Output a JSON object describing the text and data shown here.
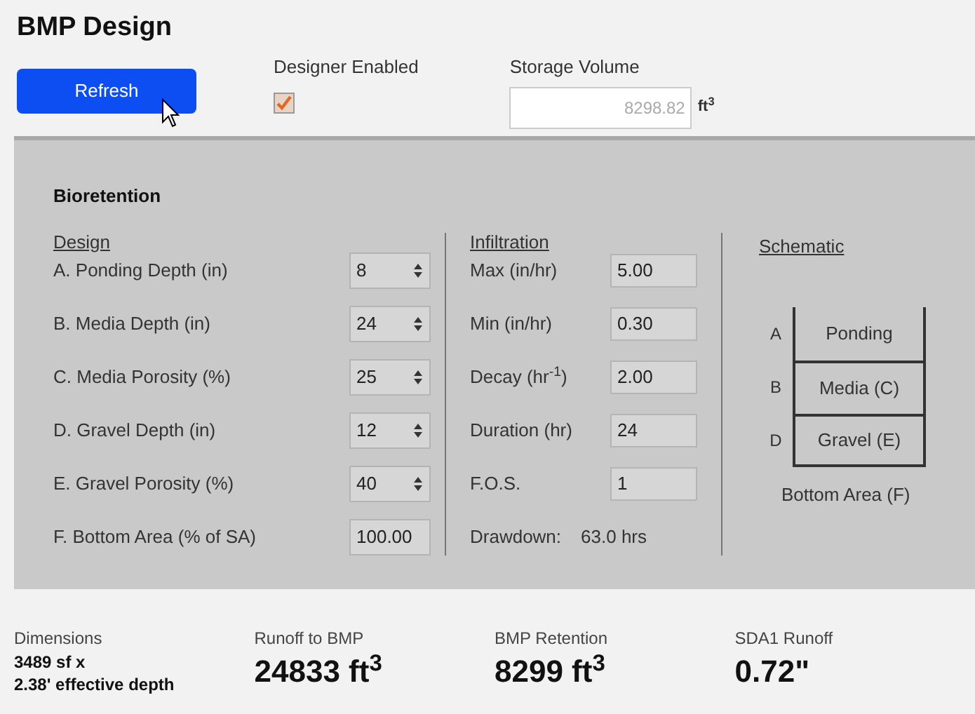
{
  "title": "BMP Design",
  "refresh_button": "Refresh",
  "designer_enabled": {
    "label": "Designer Enabled",
    "checked": true
  },
  "storage_volume": {
    "label": "Storage Volume",
    "value": "8298.82",
    "unit": "ft$^{3}$"
  },
  "panel": {
    "title": "Bioretention",
    "design": {
      "heading": "Design",
      "rows": [
        {
          "label": "A. Ponding Depth (in)",
          "value": "8",
          "kind": "spinner"
        },
        {
          "label": "B. Media Depth (in)",
          "value": "24",
          "kind": "spinner"
        },
        {
          "label": "C. Media Porosity (%)",
          "value": "25",
          "kind": "spinner"
        },
        {
          "label": "D. Gravel Depth (in)",
          "value": "12",
          "kind": "spinner"
        },
        {
          "label": "E. Gravel Porosity (%)",
          "value": "40",
          "kind": "spinner"
        },
        {
          "label": "F. Bottom Area (% of SA)",
          "value": "100.00",
          "kind": "text"
        }
      ]
    },
    "infiltration": {
      "heading": "Infiltration",
      "rows": [
        {
          "label": "Max (in/hr)",
          "value": "5.00"
        },
        {
          "label": "Min (in/hr)",
          "value": "0.30"
        },
        {
          "label": "Decay (hr$^{-1}$)",
          "value": "2.00"
        },
        {
          "label": "Duration (hr)",
          "value": "24"
        },
        {
          "label": "F.O.S.",
          "value": "1"
        }
      ],
      "drawdown": {
        "label": "Drawdown:",
        "value": "63.0 hrs"
      }
    },
    "schematic": {
      "heading": "Schematic",
      "layers": [
        {
          "letter": "A",
          "name": "Ponding"
        },
        {
          "letter": "B",
          "name": "Media (C)"
        },
        {
          "letter": "D",
          "name": "Gravel (E)"
        }
      ],
      "caption": "Bottom Area (F)"
    }
  },
  "summary": [
    {
      "label": "Dimensions",
      "kind": "small",
      "lines": [
        "3489 sf x",
        "2.38' effective depth"
      ]
    },
    {
      "label": "Runoff to BMP",
      "kind": "large",
      "lines": [
        "24833 ft$^{3}$"
      ]
    },
    {
      "label": "BMP Retention",
      "kind": "large",
      "lines": [
        "8299 ft$^{3}$"
      ]
    },
    {
      "label": "SDA1 Runoff",
      "kind": "large",
      "lines": [
        "0.72\""
      ]
    }
  ]
}
